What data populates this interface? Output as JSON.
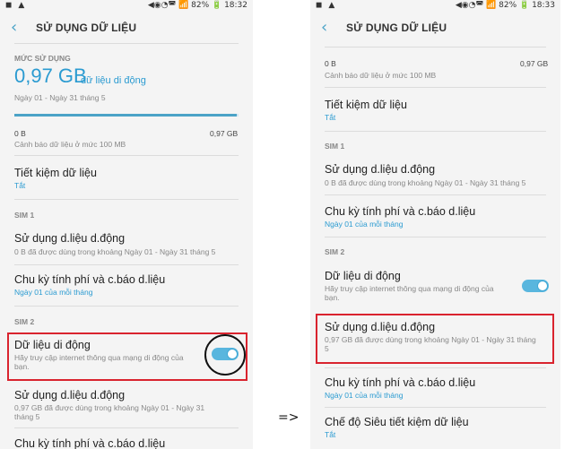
{
  "status_left": {
    "icons": "◼ ▲",
    "icons_right_panel": "◼ ▲"
  },
  "status_right": {
    "text": "◀◉◔◚ 📶 82% 🔋 18:32",
    "text_right_panel": "◀◉◔◚ 📶 82% 🔋 18:33"
  },
  "title": "SỬ DỤNG DỮ LIỆU",
  "left": {
    "usage_section": "MỨC SỬ DỤNG",
    "usage_value": "0,97 GB",
    "usage_unit": "dữ liệu di động",
    "usage_period": "Ngày 01 - Ngày 31 tháng 5",
    "usage_fraction": 0.99,
    "bar_min": "0 B",
    "bar_max": "0,97 GB",
    "warning": "Cảnh báo dữ liệu ở mức 100 MB",
    "saver_title": "Tiết kiệm dữ liệu",
    "saver_status": "Tắt",
    "sim1": "SIM 1",
    "sim1_usage_title": "Sử dụng d.liệu d.động",
    "sim1_usage_sub": "0 B đã được dùng trong khoảng Ngày 01 - Ngày 31 tháng 5",
    "sim1_cycle_title": "Chu kỳ tính phí và c.báo d.liệu",
    "sim1_cycle_sub": "Ngày 01 của mỗi tháng",
    "sim2": "SIM 2",
    "mobile_data_title": "Dữ liệu di động",
    "mobile_data_sub1": "Hãy truy cập internet thông qua mạng di động của",
    "mobile_data_sub2": "bạn.",
    "sim2_usage_title": "Sử dụng d.liệu d.động",
    "sim2_usage_sub1": "0,97 GB đã được dùng trong khoảng Ngày 01 - Ngày 31",
    "sim2_usage_sub2": "tháng 5",
    "sim2_cycle_title": "Chu kỳ tính phí và c.báo d.liệu"
  },
  "right": {
    "bar_min": "0 B",
    "bar_max": "0,97 GB",
    "warning": "Cảnh báo dữ liệu ở mức 100 MB",
    "saver_title": "Tiết kiệm dữ liệu",
    "saver_status": "Tắt",
    "sim1": "SIM 1",
    "sim1_usage_title": "Sử dụng d.liệu d.động",
    "sim1_usage_sub": "0 B đã được dùng trong khoảng Ngày 01 - Ngày 31 tháng 5",
    "sim1_cycle_title": "Chu kỳ tính phí và c.báo d.liệu",
    "sim1_cycle_sub": "Ngày 01 của mỗi tháng",
    "sim2": "SIM 2",
    "mobile_data_title": "Dữ liệu di động",
    "mobile_data_sub1": "Hãy truy cập internet thông qua mạng di động của",
    "mobile_data_sub2": "bạn.",
    "sim2_usage_title": "Sử dụng d.liệu d.động",
    "sim2_usage_sub1": "0,97 GB đã được dùng trong khoảng Ngày 01 - Ngày 31 tháng",
    "sim2_usage_sub2": "5",
    "sim2_cycle_title": "Chu kỳ tính phí và c.báo d.liệu",
    "sim2_cycle_sub": "Ngày 01 của mỗi tháng",
    "ultra_saver_title": "Chế độ Siêu tiết kiệm dữ liệu",
    "ultra_saver_status": "Tắt"
  },
  "arrow": "=>",
  "colors": {
    "accent": "#2b9bd1",
    "highlight": "#d9232e"
  }
}
